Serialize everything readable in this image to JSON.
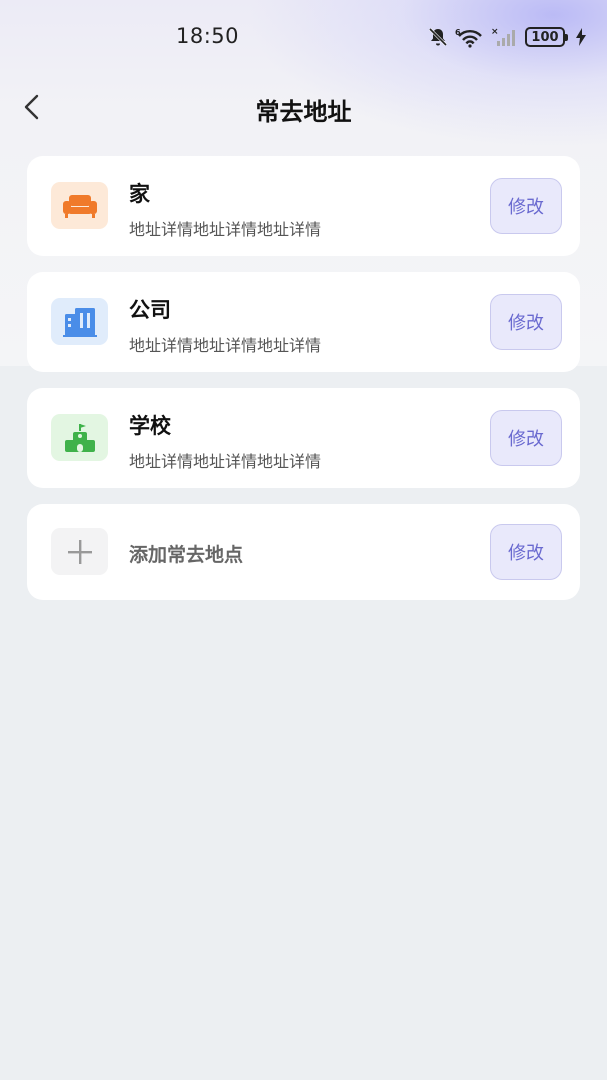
{
  "status_bar": {
    "time": "18:50",
    "battery": "100"
  },
  "nav": {
    "title": "常去地址"
  },
  "addresses": [
    {
      "name": "家",
      "detail": "地址详情地址详情地址详情",
      "icon": "sofa-icon",
      "icon_color": "#f07a2a",
      "icon_bg": "#fde9d8",
      "edit_label": "修改"
    },
    {
      "name": "公司",
      "detail": "地址详情地址详情地址详情",
      "icon": "building-icon",
      "icon_color": "#4a8de8",
      "icon_bg": "#e0ecfb",
      "edit_label": "修改"
    },
    {
      "name": "学校",
      "detail": "地址详情地址详情地址详情",
      "icon": "school-icon",
      "icon_color": "#3fb24a",
      "icon_bg": "#e3f6e2",
      "edit_label": "修改"
    }
  ],
  "add_place": {
    "label": "添加常去地点",
    "icon": "plus-icon",
    "edit_label": "修改"
  },
  "colors": {
    "accent": "#6a6ad0",
    "accent_bg": "#e9e9fb",
    "page_bg": "#eceff2"
  }
}
